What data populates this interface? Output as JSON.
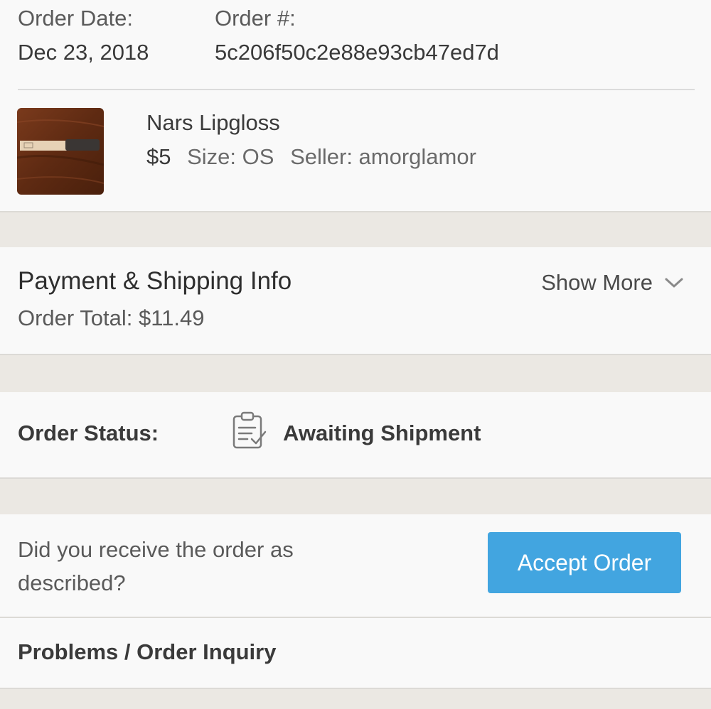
{
  "order": {
    "date_label": "Order Date:",
    "date_value": "Dec 23, 2018",
    "number_label": "Order #:",
    "number_value": "5c206f50c2e88e93cb47ed7d"
  },
  "product": {
    "name": "Nars Lipgloss",
    "price": "$5",
    "size": "Size: OS",
    "seller": "Seller: amorglamor"
  },
  "payment": {
    "title": "Payment & Shipping Info",
    "total": "Order Total: $11.49",
    "show_more": "Show More",
    "show_more_icon": "chevron-down-icon"
  },
  "status": {
    "label": "Order Status:",
    "value": "Awaiting Shipment",
    "icon": "clipboard-check-icon"
  },
  "accept": {
    "question": "Did you receive the order as described?",
    "button": "Accept Order",
    "button_color": "#42a5e0"
  },
  "problems": {
    "label": "Problems / Order Inquiry"
  },
  "colors": {
    "background": "#ebe8e3",
    "card": "#f9f9f9",
    "accent": "#42a5e0"
  }
}
